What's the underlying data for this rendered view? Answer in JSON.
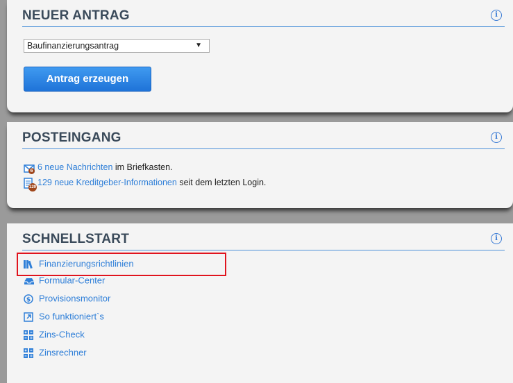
{
  "antrag": {
    "title": "NEUER ANTRAG",
    "select_value": "Baufinanzierungsantrag",
    "button_label": "Antrag erzeugen"
  },
  "posteingang": {
    "title": "POSTEINGANG",
    "messages_link": "6 neue Nachrichten",
    "messages_suffix": " im Briefkasten.",
    "messages_badge": "6",
    "info_link": "129 neue Kreditgeber-Informationen",
    "info_suffix": " seit dem letzten Login.",
    "info_badge": "129"
  },
  "schnellstart": {
    "title": "SCHNELLSTART",
    "items": [
      {
        "label": "Finanzierungsrichtlinien",
        "icon": "books-icon"
      },
      {
        "label": "Formular-Center",
        "icon": "inbox-tray-icon"
      },
      {
        "label": "Provisionsmonitor",
        "icon": "dollar-circle-icon"
      },
      {
        "label": "So funktioniert`s",
        "icon": "external-link-icon"
      },
      {
        "label": "Zins-Check",
        "icon": "calculator-icon"
      },
      {
        "label": "Zinsrechner",
        "icon": "calculator-icon"
      }
    ]
  },
  "info_icon_glyph": "i",
  "colors": {
    "accent": "#2f7fd8",
    "highlight": "#e0141e",
    "badge": "#a0461a"
  }
}
